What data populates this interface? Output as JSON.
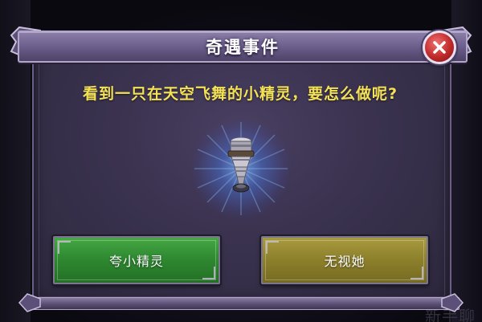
{
  "dialog": {
    "title": "奇遇事件",
    "question": "看到一只在天空飞舞的小精灵，要怎么做呢?",
    "item_icon": "spirit-lamp-icon",
    "close_icon": "close-icon"
  },
  "actions": {
    "praise_label": "夸小精灵",
    "ignore_label": "无视她"
  },
  "background": {
    "partial_text": "新手聊"
  },
  "colors": {
    "question_text": "#f3e255",
    "praise_button": "#2f8a31",
    "ignore_button": "#8f822d",
    "close_button": "#c02a2a",
    "panel": "#3b3350"
  }
}
